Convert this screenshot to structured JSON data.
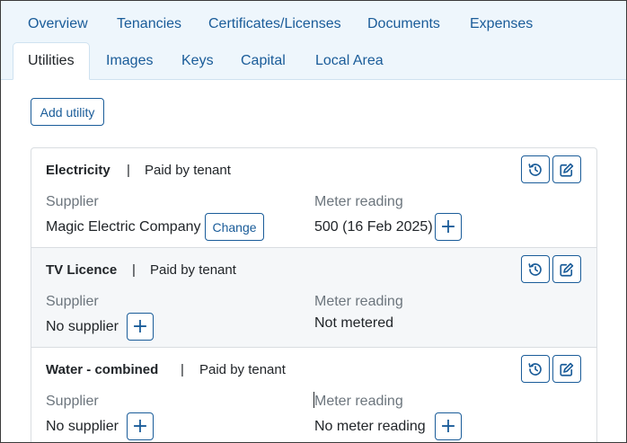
{
  "tabs_row1": [
    "Overview",
    "Tenancies",
    "Certificates/Licenses",
    "Documents",
    "Expenses"
  ],
  "tabs_row2": [
    "Utilities",
    "Images",
    "Keys",
    "Capital",
    "Local Area"
  ],
  "active_tab": "Utilities",
  "add_utility_label": "Add utility",
  "separator": "|",
  "utilities": [
    {
      "name": "Electricity",
      "paid_by": "Paid by tenant",
      "supplier_label": "Supplier",
      "supplier": "Magic Electric Company",
      "supplier_button": "Change",
      "meter_label": "Meter reading",
      "meter": "500 (16 Feb 2025)"
    },
    {
      "name": "TV Licence",
      "paid_by": "Paid by tenant",
      "supplier_label": "Supplier",
      "supplier": "No supplier",
      "meter_label": "Meter reading",
      "meter": "Not metered"
    },
    {
      "name": "Water - combined",
      "paid_by": "Paid by tenant",
      "supplier_label": "Supplier",
      "supplier": "No supplier",
      "meter_label": "Meter reading",
      "meter": "No meter reading"
    }
  ],
  "colors": {
    "accent": "#1a5c99",
    "tab_bg": "#eef6fc",
    "muted": "#6c757d"
  },
  "icons": [
    "history-icon",
    "edit-icon",
    "plus-icon"
  ]
}
